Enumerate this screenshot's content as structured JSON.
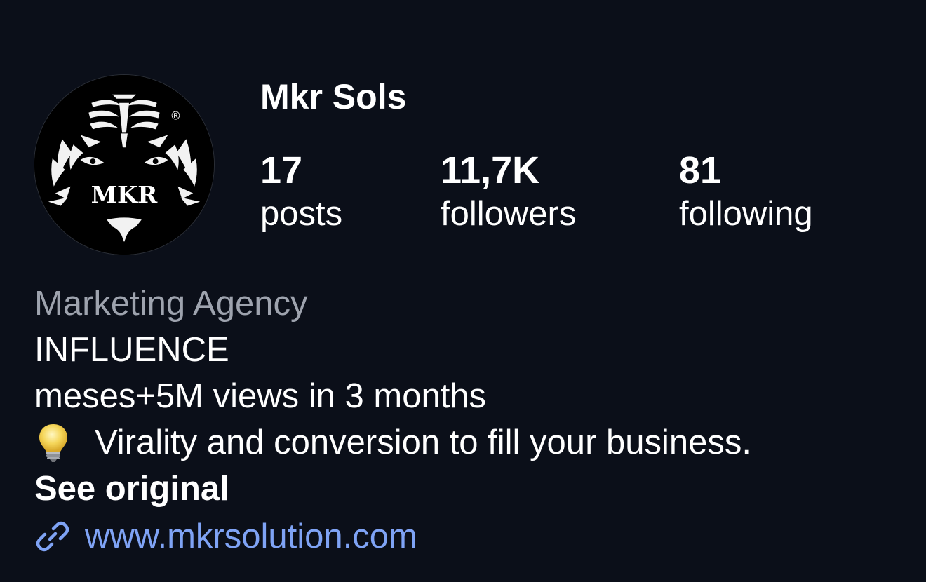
{
  "profile": {
    "username": "Mkr Sols",
    "avatar": {
      "icon": "tiger-logo-icon",
      "logo_text": "MKR",
      "registered_mark": "®"
    }
  },
  "stats": {
    "posts": {
      "count": "17",
      "label": "posts"
    },
    "followers": {
      "count": "11,7K",
      "label": "followers"
    },
    "following": {
      "count": "81",
      "label": "following"
    }
  },
  "bio": {
    "category": "Marketing Agency",
    "lines": [
      "INFLUENCE",
      "meses+5M views in 3 months",
      "Virality and conversion to fill your business."
    ],
    "bulb_icon": "light-bulb-icon",
    "see_original": "See original",
    "link_icon": "link-icon",
    "website": "www.mkrsolution.com"
  },
  "colors": {
    "background": "#0b0f19",
    "text": "#ffffff",
    "secondary_text": "#9ea3ae",
    "link": "#7fa3f5"
  }
}
